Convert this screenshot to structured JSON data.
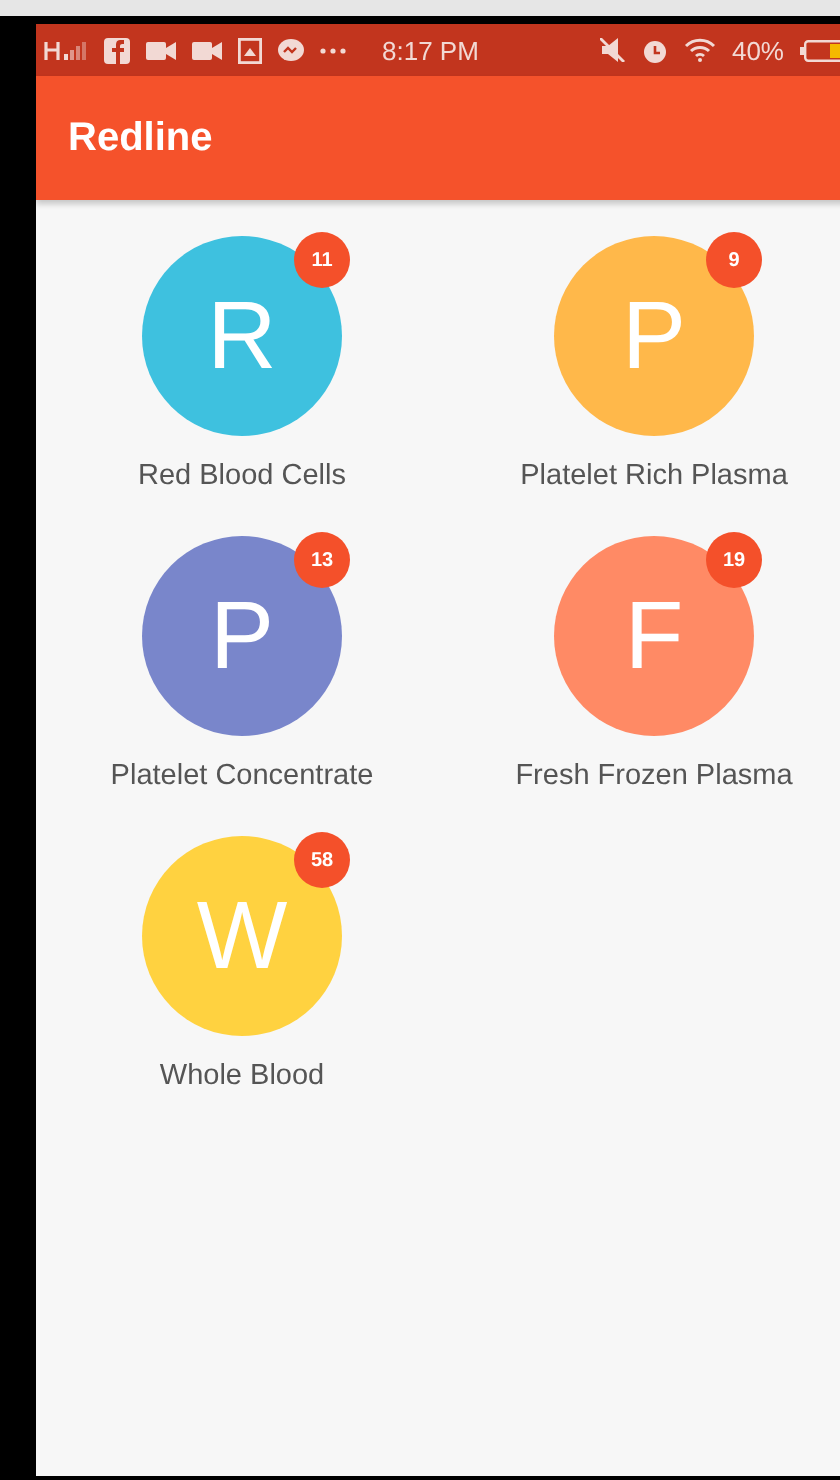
{
  "status_bar": {
    "time": "8:17 PM",
    "battery": "40%"
  },
  "app_bar": {
    "title": "Redline"
  },
  "items": [
    {
      "letter": "R",
      "count": "11",
      "label": "Red Blood Cells",
      "color": "#3ec1df"
    },
    {
      "letter": "P",
      "count": "9",
      "label": "Platelet Rich Plasma",
      "color": "#ffb84a"
    },
    {
      "letter": "P",
      "count": "13",
      "label": "Platelet Concentrate",
      "color": "#7986cb"
    },
    {
      "letter": "F",
      "count": "19",
      "label": "Fresh Frozen Plasma",
      "color": "#ff8a65"
    },
    {
      "letter": "W",
      "count": "58",
      "label": "Whole Blood",
      "color": "#ffd240"
    }
  ]
}
